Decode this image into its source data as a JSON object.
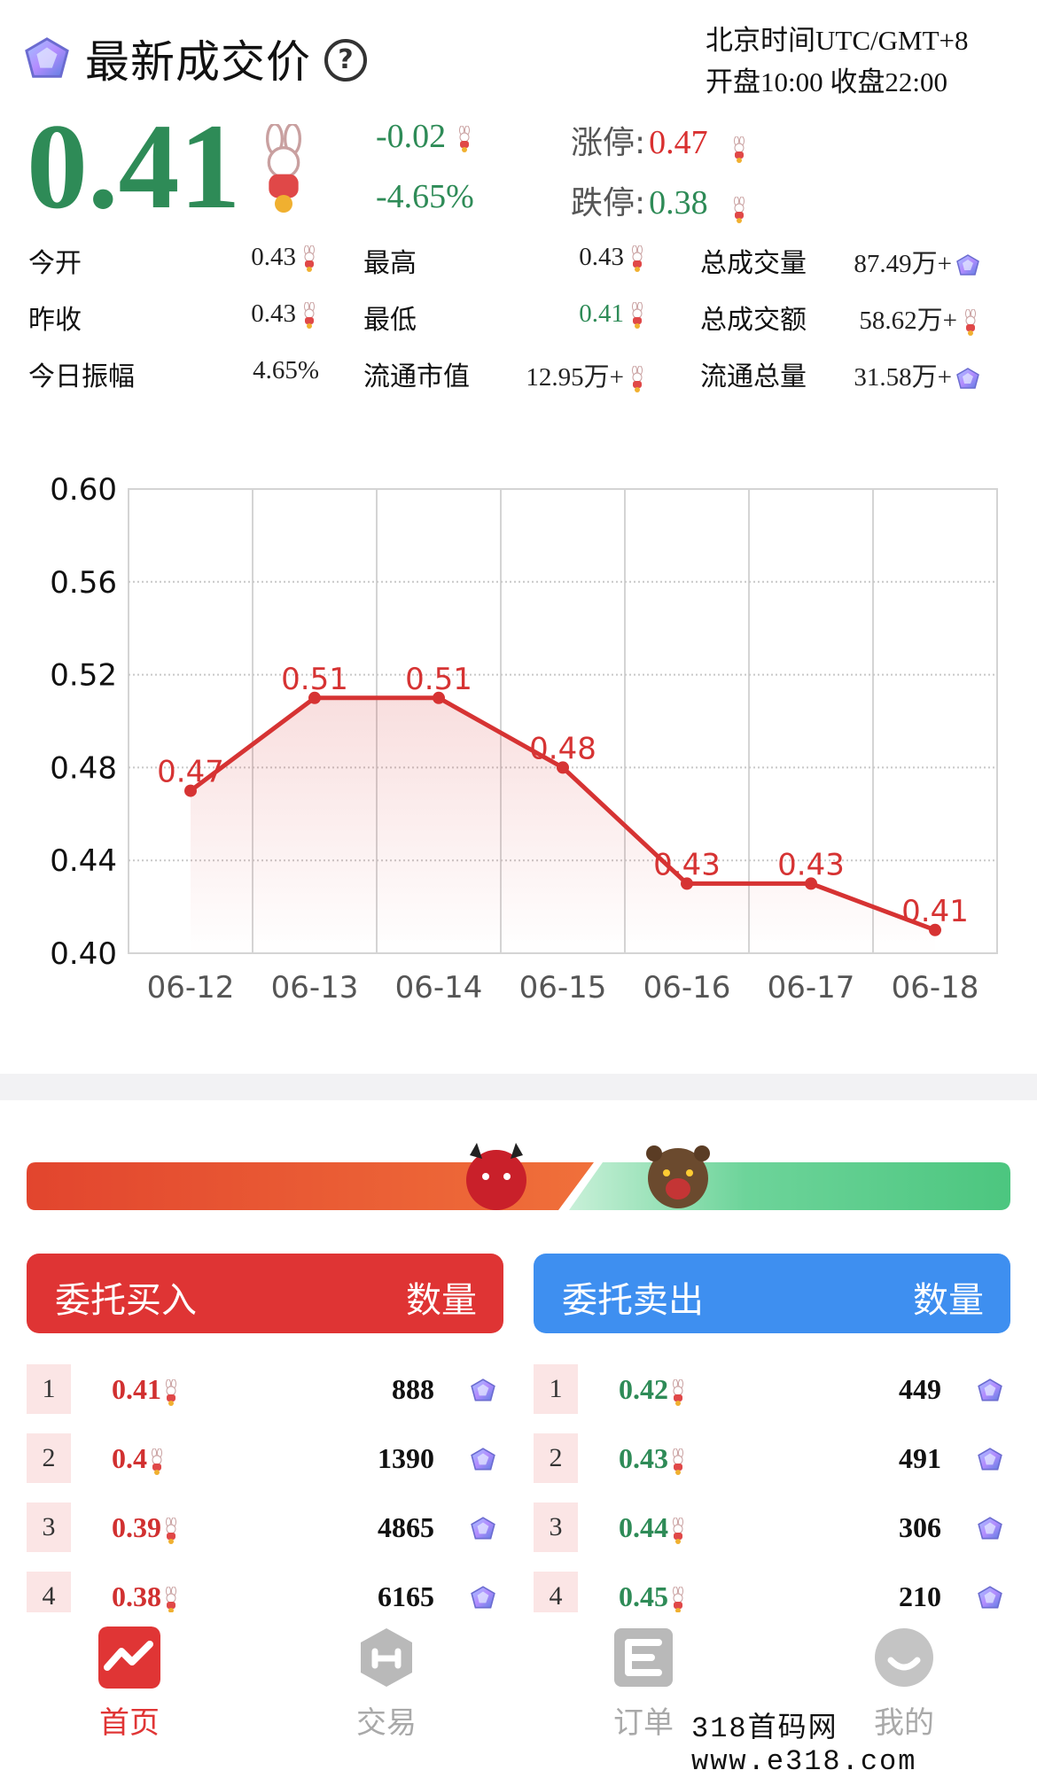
{
  "header": {
    "title": "最新成交价",
    "help_glyph": "?",
    "timezone_line1": "北京时间UTC/GMT+8",
    "timezone_line2": "开盘10:00 收盘22:00"
  },
  "quote": {
    "last_price": "0.41",
    "change": "-0.02",
    "change_pct": "-4.65%",
    "limit_up_label": "涨停:",
    "limit_up": "0.47",
    "limit_down_label": "跌停:",
    "limit_down": "0.38"
  },
  "stats": {
    "rows": [
      [
        {
          "label": "今开",
          "value": "0.43",
          "icon": "mascot"
        },
        {
          "label": "最高",
          "value": "0.43",
          "icon": "mascot"
        },
        {
          "label": "总成交量",
          "value": "87.49万+",
          "icon": "gem"
        }
      ],
      [
        {
          "label": "昨收",
          "value": "0.43",
          "icon": "mascot"
        },
        {
          "label": "最低",
          "value": "0.41",
          "icon": "mascot",
          "color": "#2e8b57"
        },
        {
          "label": "总成交额",
          "value": "58.62万+",
          "icon": "mascot"
        }
      ],
      [
        {
          "label": "今日振幅",
          "value": "4.65%",
          "icon": ""
        },
        {
          "label": "流通市值",
          "value": "12.95万+",
          "icon": "mascot"
        },
        {
          "label": "流通总量",
          "value": "31.58万+",
          "icon": "gem"
        }
      ]
    ]
  },
  "chart_data": {
    "type": "line",
    "categories": [
      "06-12",
      "06-13",
      "06-14",
      "06-15",
      "06-16",
      "06-17",
      "06-18"
    ],
    "values": [
      0.47,
      0.51,
      0.51,
      0.48,
      0.43,
      0.43,
      0.41
    ],
    "data_labels": [
      "0.47",
      "0.51",
      "0.51",
      "0.48",
      "0.43",
      "0.43",
      "0.41"
    ],
    "y_ticks": [
      "0.60",
      "0.56",
      "0.52",
      "0.48",
      "0.44",
      "0.40"
    ],
    "ylim": [
      0.4,
      0.6
    ],
    "grid": true,
    "line_color": "#d63333"
  },
  "orderbook": {
    "buy_title": "委托买入",
    "sell_title": "委托卖出",
    "qty_title": "数量",
    "buy_color": "#df3434",
    "sell_color": "#3e8ff0",
    "buys": [
      {
        "idx": "1",
        "price": "0.41",
        "qty": "888"
      },
      {
        "idx": "2",
        "price": "0.4",
        "qty": "1390"
      },
      {
        "idx": "3",
        "price": "0.39",
        "qty": "4865"
      },
      {
        "idx": "4",
        "price": "0.38",
        "qty": "6165"
      }
    ],
    "sells": [
      {
        "idx": "1",
        "price": "0.42",
        "qty": "449"
      },
      {
        "idx": "2",
        "price": "0.43",
        "qty": "491"
      },
      {
        "idx": "3",
        "price": "0.44",
        "qty": "306"
      },
      {
        "idx": "4",
        "price": "0.45",
        "qty": "210"
      }
    ]
  },
  "nav": {
    "items": [
      {
        "label": "首页",
        "active": true
      },
      {
        "label": "交易",
        "active": false
      },
      {
        "label": "订单",
        "active": false
      },
      {
        "label": "我的",
        "active": false
      }
    ],
    "active_color": "#e03535",
    "inactive_color": "#a9a9a9"
  },
  "watermark": "318首码网 www.e318.com"
}
